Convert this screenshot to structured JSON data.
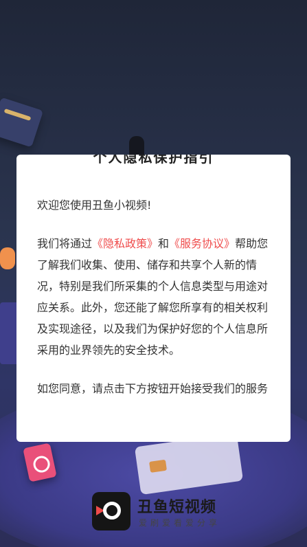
{
  "dialog": {
    "title": "个人隐私保护指引",
    "welcome": "欢迎您使用丑鱼小视频!",
    "p1_prefix": "我们将通过",
    "privacy_link": "《隐私政策》",
    "and": "和",
    "service_link": "《服务协议》",
    "p1_suffix": "帮助您了解我们收集、使用、储存和共享个人新的情况，特别是我们所采集的个人信息类型与用途对应关系。此外，您还能了解您所享有的相关权利及实现途径，以及我们为保护好您的个人信息所采用的业界领先的安全技术。",
    "p2": "如您同意，请点击下方按钮开始接受我们的服务"
  },
  "brand": {
    "name": "丑鱼短视频",
    "slogan": "爱刷爱看爱分享"
  },
  "colors": {
    "link": "#ef4b4b",
    "dialog_bg": "#ffffff"
  }
}
